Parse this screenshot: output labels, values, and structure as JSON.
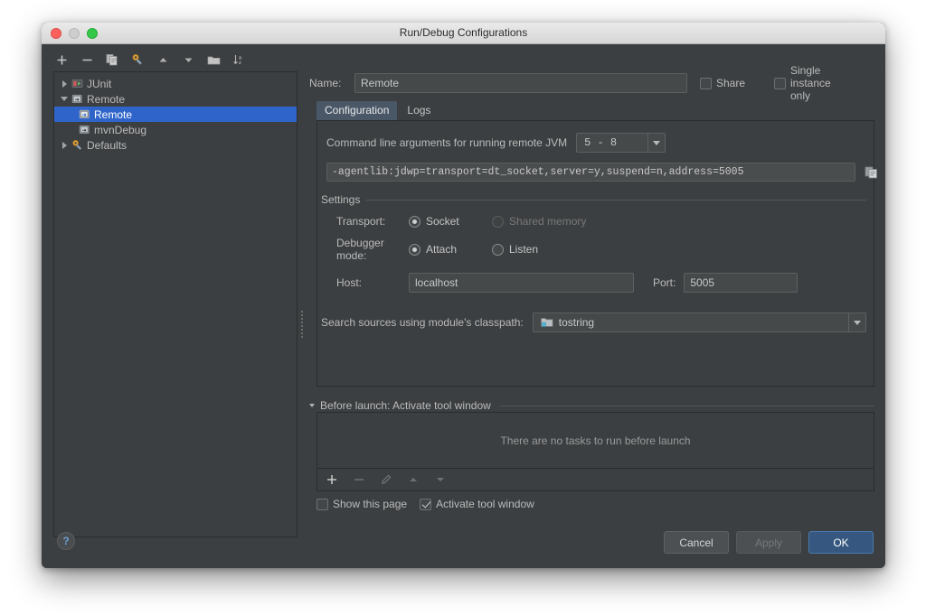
{
  "window": {
    "title": "Run/Debug Configurations",
    "traffic_lights": [
      "close-red",
      "minimize-grey",
      "zoom-green"
    ]
  },
  "sidebar": {
    "toolbar": [
      {
        "name": "add-configuration",
        "glyph": "+"
      },
      {
        "name": "remove-configuration",
        "glyph": "−"
      },
      {
        "name": "copy-configuration",
        "glyph": "copy-icon"
      },
      {
        "name": "edit-defaults",
        "glyph": "wrench-icon"
      },
      {
        "name": "move-up",
        "glyph": "▲"
      },
      {
        "name": "move-down",
        "glyph": "▼"
      },
      {
        "name": "create-folder",
        "glyph": "folder-icon"
      },
      {
        "name": "sort-configurations",
        "glyph": "sort-az-icon"
      }
    ],
    "tree": [
      {
        "label": "JUnit",
        "level": 0,
        "expander": "collapsed",
        "icon": "junit-icon",
        "selected": false
      },
      {
        "label": "Remote",
        "level": 0,
        "expander": "expanded",
        "icon": "remote-icon",
        "selected": false
      },
      {
        "label": "Remote",
        "level": 1,
        "expander": "none",
        "icon": "remote-icon",
        "selected": true
      },
      {
        "label": "mvnDebug",
        "level": 1,
        "expander": "none",
        "icon": "remote-icon",
        "selected": false
      },
      {
        "label": "Defaults",
        "level": 0,
        "expander": "collapsed",
        "icon": "wrench-icon",
        "selected": false
      }
    ]
  },
  "main": {
    "name_label": "Name:",
    "name_value": "Remote",
    "share_label": "Share",
    "share_checked": false,
    "single_instance_label": "Single instance only",
    "single_instance_checked": false,
    "tabs": [
      {
        "label": "Configuration",
        "active": true
      },
      {
        "label": "Logs",
        "active": false
      }
    ],
    "command_line_label": "Command line arguments for running remote JVM",
    "jvm_version": "5 - 8",
    "agent_args": "-agentlib:jdwp=transport=dt_socket,server=y,suspend=n,address=5005",
    "copy_icon": "copy-to-clipboard-icon",
    "settings_group_label": "Settings",
    "transport_label": "Transport:",
    "transport_options": [
      {
        "label": "Socket",
        "selected": true,
        "disabled": false
      },
      {
        "label": "Shared memory",
        "selected": false,
        "disabled": true
      }
    ],
    "debugger_mode_label": "Debugger mode:",
    "debugger_mode_options": [
      {
        "label": "Attach",
        "selected": true,
        "disabled": false
      },
      {
        "label": "Listen",
        "selected": false,
        "disabled": false
      }
    ],
    "host_label": "Host:",
    "host_value": "localhost",
    "port_label": "Port:",
    "port_value": "5005",
    "search_sources_label": "Search sources using module's classpath:",
    "module_value": "tostring",
    "module_icon": "module-folder-icon"
  },
  "before_launch": {
    "header": "Before launch: Activate tool window",
    "empty_message": "There are no tasks to run before launch",
    "toolbar": [
      {
        "name": "add-task",
        "glyph": "+",
        "disabled": false
      },
      {
        "name": "remove-task",
        "glyph": "−",
        "disabled": true
      },
      {
        "name": "edit-task",
        "glyph": "pencil-icon",
        "disabled": true
      },
      {
        "name": "move-task-up",
        "glyph": "▲",
        "disabled": true
      },
      {
        "name": "move-task-down",
        "glyph": "▼",
        "disabled": true
      }
    ],
    "show_page_label": "Show this page",
    "show_page_checked": false,
    "activate_tool_window_label": "Activate tool window",
    "activate_tool_window_checked": true
  },
  "footer": {
    "help_glyph": "?",
    "cancel_label": "Cancel",
    "apply_label": "Apply",
    "ok_label": "OK"
  },
  "colors": {
    "window_bg": "#3c3f41",
    "selection_blue": "#2f65ca",
    "primary_button": "#365880",
    "tab_active": "#4a5767",
    "field_bg": "#45494a"
  }
}
